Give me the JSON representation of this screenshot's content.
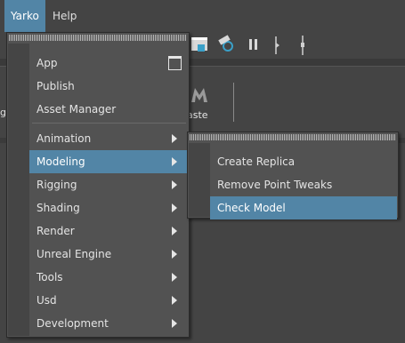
{
  "menubar": {
    "items": [
      {
        "label": "Yarko",
        "active": true
      },
      {
        "label": "Help",
        "active": false
      }
    ]
  },
  "background": {
    "shelf_label_partial": "aste",
    "left_edge_text": "g"
  },
  "menu": {
    "items": [
      {
        "label": "App",
        "has_option_box": true
      },
      {
        "label": "Publish"
      },
      {
        "label": "Asset Manager"
      },
      {
        "label": "Animation",
        "submenu": true
      },
      {
        "label": "Modeling",
        "submenu": true,
        "highlight": true
      },
      {
        "label": "Rigging",
        "submenu": true
      },
      {
        "label": "Shading",
        "submenu": true
      },
      {
        "label": "Render",
        "submenu": true
      },
      {
        "label": "Unreal Engine",
        "submenu": true
      },
      {
        "label": "Tools",
        "submenu": true
      },
      {
        "label": "Usd",
        "submenu": true
      },
      {
        "label": "Development",
        "submenu": true
      }
    ]
  },
  "submenu": {
    "parent": "Modeling",
    "items": [
      {
        "label": "Create Replica"
      },
      {
        "label": "Remove Point Tweaks"
      },
      {
        "label": "Check Model",
        "highlight": true
      }
    ]
  },
  "colors": {
    "highlight": "#5285a6",
    "menu_bg": "#525252",
    "app_bg": "#444444"
  }
}
